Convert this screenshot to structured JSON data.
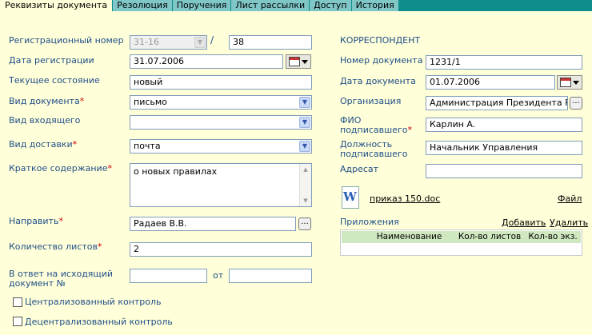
{
  "tabs": [
    {
      "label": "Реквизиты документа",
      "active": true
    },
    {
      "label": "Резолюция"
    },
    {
      "label": "Поручения"
    },
    {
      "label": "Лист рассылки"
    },
    {
      "label": "Доступ"
    },
    {
      "label": "История"
    }
  ],
  "left": {
    "reg_number_label": "Регистрационный номер",
    "reg_number_prefix": "31-16",
    "reg_number_sep": "/",
    "reg_number_value": "38",
    "reg_date_label": "Дата регистрации",
    "reg_date_value": "31.07.2006",
    "status_label": "Текущее состояние",
    "status_value": "новый",
    "doc_type_label": "Вид документа",
    "doc_type_value": "письмо",
    "incoming_type_label": "Вид входящего",
    "incoming_type_value": "",
    "delivery_label": "Вид доставки",
    "delivery_value": "почта",
    "summary_label": "Краткое содержание",
    "summary_value": "о новых правилах",
    "direct_label": "Направить",
    "direct_value": "Радаев В.В.",
    "sheets_label": "Количество листов",
    "sheets_value": "2",
    "reply_label_1": "В ответ на исходящий",
    "reply_label_2": "документ №",
    "reply_from_label": "от",
    "central_control_label": "Централизованный контроль",
    "decentral_control_label": "Децентрализованный контроль"
  },
  "right": {
    "section_title": "КОРРЕСПОНДЕНТ",
    "doc_number_label": "Номер документа",
    "doc_number_value": "1231/1",
    "doc_date_label": "Дата документа",
    "doc_date_value": "01.07.2006",
    "org_label": "Организация",
    "org_value": "Администрация Президента Р",
    "signer_label_1": "ФИО",
    "signer_label_2": "подписавшего",
    "signer_value": "Карлин А.",
    "position_label_1": "Должность",
    "position_label_2": "подписавшего",
    "position_value": "Начальник Управления",
    "addressee_label": "Адресат",
    "addressee_value": "",
    "file_name": "приказ 150.doc",
    "file_link": "Файл",
    "attachments_label": "Приложения",
    "add_link": "Добавить",
    "delete_link": "Удалить",
    "grid_columns": [
      "Наименование",
      "Кол-во листов",
      "Кол-во экз."
    ]
  },
  "colors": {
    "background": "#ffffd9",
    "tabbar": "#0f8c8c",
    "label": "#1f4e88",
    "required": "#cc0000"
  }
}
